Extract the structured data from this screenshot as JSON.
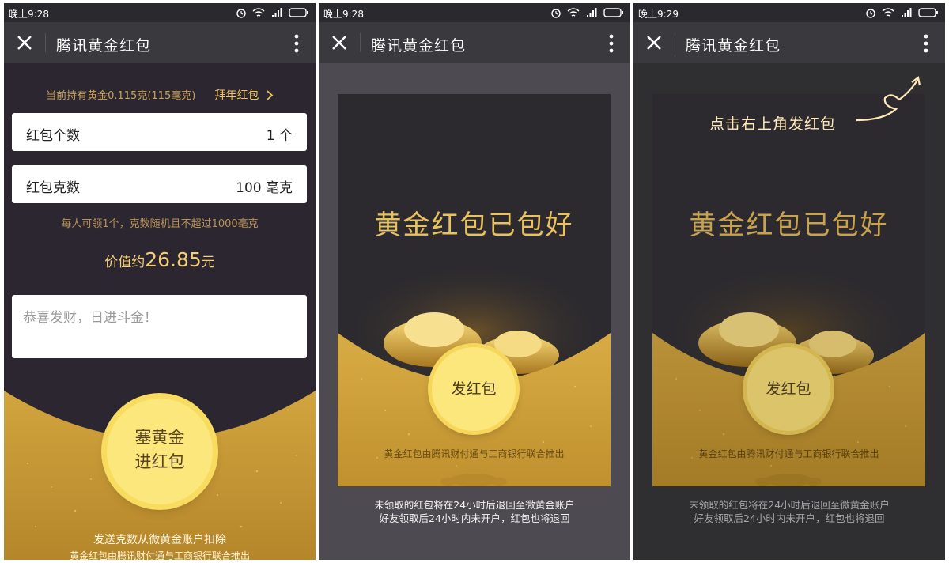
{
  "status": {
    "time1": "晚上9:28",
    "time2": "晚上9:28",
    "time3": "晚上9:29"
  },
  "appbar": {
    "title": "腾讯黄金红包"
  },
  "panel1": {
    "holding": "当前持有黄金0.115克(115毫克)",
    "new_year_link": "拜年红包",
    "count_label": "红包个数",
    "count_value": "1 个",
    "grams_label": "红包克数",
    "grams_value": "100 毫克",
    "rule": "每人可领1个，克数随机且不超过1000毫克",
    "worth_prefix": "价值约",
    "worth_value": "26.85",
    "worth_unit": "元",
    "message_placeholder": "恭喜发财，日进斗金！",
    "stuff_line1": "塞黄金",
    "stuff_line2": "进红包",
    "deduct_note": "发送克数从微黄金账户扣除",
    "partner_note": "黄金红包由腾讯财付通与工商银行联合推出"
  },
  "panel2": {
    "headline": "黄金红包已包好",
    "send_button": "发红包",
    "partner_note": "黄金红包由腾讯财付通与工商银行联合推出",
    "note_line1": "未领取的红包将在24小时后退回至微黄金账户",
    "note_line2": "好友领取后24小时内未开户，红包也将退回"
  },
  "panel3": {
    "hint": "点击右上角发红包",
    "headline": "黄金红包已包好",
    "send_button": "发红包",
    "partner_note": "黄金红包由腾讯财付通与工商银行联合推出",
    "note_line1": "未领取的红包将在24小时后退回至微黄金账户",
    "note_line2": "好友领取后24小时内未开户，红包也将退回"
  },
  "colors": {
    "gold": "#e8c25e",
    "gold_light": "#fbe77c",
    "bg_dark": "#2b2630",
    "appbar": "#3a393d"
  }
}
